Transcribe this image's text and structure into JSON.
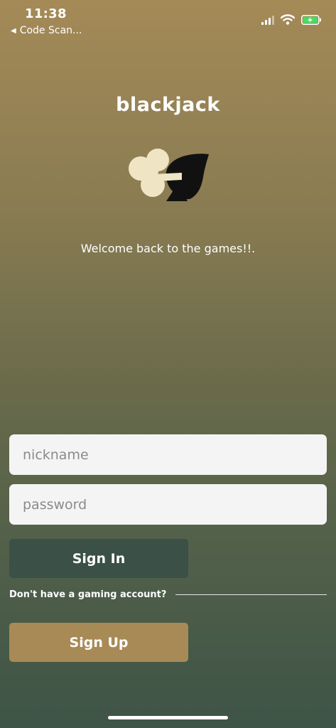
{
  "status_bar": {
    "time": "11:38",
    "back_label": "Code Scan...",
    "back_icon": "left-triangle-icon",
    "signal_icon": "cellular-signal-icon",
    "wifi_icon": "wifi-icon",
    "battery_icon": "battery-charging-icon"
  },
  "brand": {
    "title": "blackjack",
    "logo_icon": "club-spade-logo-icon",
    "welcome": "Welcome back to the games!!."
  },
  "form": {
    "nickname_placeholder": "nickname",
    "password_placeholder": "password",
    "sign_in_label": "Sign In",
    "no_account_text": "Don't have a gaming account?",
    "sign_up_label": "Sign Up"
  },
  "colors": {
    "gradient_top": "#a48a57",
    "gradient_bottom": "#3e5446",
    "sign_in_bg": "#3b5046",
    "sign_up_bg": "#a88a57",
    "input_bg": "#f4f4f4",
    "club_color": "#efe5c5",
    "spade_color": "#111111",
    "battery_green": "#4cd964"
  }
}
